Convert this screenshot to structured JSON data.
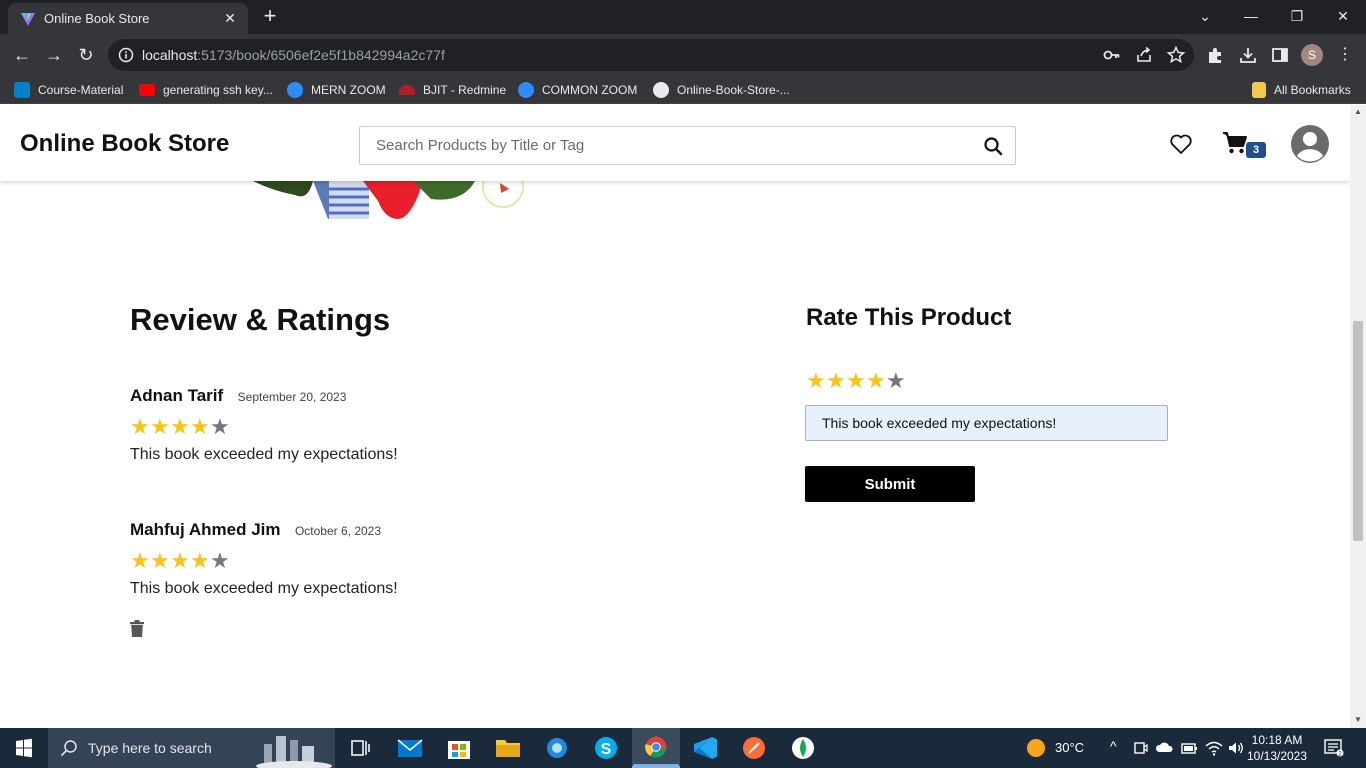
{
  "browser": {
    "tab_title": "Online Book Store",
    "url_host": "localhost",
    "url_path": ":5173/book/6506ef2e5f1b842994a2c77f",
    "profile_initial": "S",
    "bookmarks": [
      {
        "label": "Course-Material",
        "icon": "nextcloud-icon",
        "color": "#0082c9"
      },
      {
        "label": "generating ssh key...",
        "icon": "youtube-icon",
        "color": "#ff0000"
      },
      {
        "label": "MERN ZOOM",
        "icon": "zoom-icon",
        "color": "#2d8cff"
      },
      {
        "label": "BJIT - Redmine",
        "icon": "redmine-icon",
        "color": "#b32024"
      },
      {
        "label": "COMMON ZOOM",
        "icon": "zoom-icon",
        "color": "#2d8cff"
      },
      {
        "label": "Online-Book-Store-...",
        "icon": "github-icon",
        "color": "#ffffff"
      }
    ],
    "all_bookmarks_label": "All Bookmarks"
  },
  "header": {
    "site_title": "Online Book Store",
    "search_placeholder": "Search Products by Title or Tag",
    "cart_count": "3"
  },
  "reviews": {
    "title": "Review & Ratings",
    "items": [
      {
        "name": "Adnan Tarif",
        "date": "September 20, 2023",
        "rating": 4,
        "text": "This book exceeded my expectations!"
      },
      {
        "name": "Mahfuj Ahmed Jim",
        "date": "October 6, 2023",
        "rating": 4,
        "text": "This book exceeded my expectations!"
      }
    ]
  },
  "rate": {
    "title": "Rate This Product",
    "rating": 4,
    "comment_value": "This book exceeded my expectations!",
    "submit_label": "Submit"
  },
  "taskbar": {
    "search_placeholder": "Type here to search",
    "weather": "30°C",
    "time": "10:18 AM",
    "date": "10/13/2023"
  },
  "colors": {
    "star_on": "#f5c518",
    "star_off": "#777777",
    "cart_badge": "#1f4f8f",
    "submit_bg": "#000000",
    "input_bg": "#e8f0fe"
  }
}
